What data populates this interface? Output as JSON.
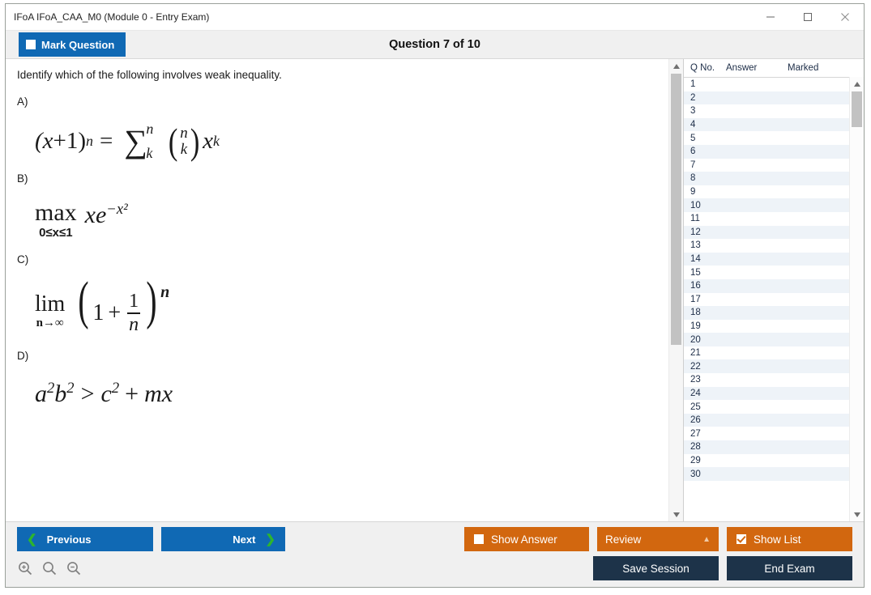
{
  "window": {
    "title": "IFoA IFoA_CAA_M0 (Module 0 - Entry Exam)",
    "minimize_label": "—",
    "maximize_label": "□",
    "close_label": "✕"
  },
  "header": {
    "mark_question_label": "Mark Question",
    "mark_question_checked": false,
    "question_title": "Question 7 of 10"
  },
  "question": {
    "prompt": "Identify which of the following involves weak inequality.",
    "options": [
      {
        "label": "A)",
        "formula_text": "(x+1)^n = Σ_k^n (n choose k) x^k",
        "lhs_base": "(x",
        "lhs_plus": "+1)",
        "lhs_exp": "n",
        "equals": "=",
        "sigma": "∑",
        "sigma_sup": "n",
        "sigma_sub": "k",
        "binom_top": "n",
        "binom_bottom": "k",
        "tail_base": "x",
        "tail_exp": "k"
      },
      {
        "label": "B)",
        "formula_text": "max (0≤x≤1) x e^{-x^2}",
        "operator": "max",
        "limits": "0≤x≤1",
        "expr_base": "xe",
        "expr_exp": "−x²"
      },
      {
        "label": "C)",
        "formula_text": "lim (n→∞) (1 + 1/n)^n",
        "operator": "lim",
        "limits": "n→∞",
        "paren_open": "(",
        "one": "1",
        "plus": "+",
        "frac_num": "1",
        "frac_den": "n",
        "paren_close": ")",
        "power": "n"
      },
      {
        "label": "D)",
        "formula_text": "a²b² > c² + mx",
        "a": "a",
        "a_exp": "2",
        "b": "b",
        "b_exp": "2",
        "gt": ">",
        "c": "c",
        "c_exp": "2",
        "plus": "+",
        "mx": "mx"
      }
    ]
  },
  "question_list": {
    "columns": [
      "Q No.",
      "Answer",
      "Marked"
    ],
    "rows": [
      {
        "q": "1",
        "answer": "",
        "marked": ""
      },
      {
        "q": "2",
        "answer": "",
        "marked": ""
      },
      {
        "q": "3",
        "answer": "",
        "marked": ""
      },
      {
        "q": "4",
        "answer": "",
        "marked": ""
      },
      {
        "q": "5",
        "answer": "",
        "marked": ""
      },
      {
        "q": "6",
        "answer": "",
        "marked": ""
      },
      {
        "q": "7",
        "answer": "",
        "marked": ""
      },
      {
        "q": "8",
        "answer": "",
        "marked": ""
      },
      {
        "q": "9",
        "answer": "",
        "marked": ""
      },
      {
        "q": "10",
        "answer": "",
        "marked": ""
      },
      {
        "q": "11",
        "answer": "",
        "marked": ""
      },
      {
        "q": "12",
        "answer": "",
        "marked": ""
      },
      {
        "q": "13",
        "answer": "",
        "marked": ""
      },
      {
        "q": "14",
        "answer": "",
        "marked": ""
      },
      {
        "q": "15",
        "answer": "",
        "marked": ""
      },
      {
        "q": "16",
        "answer": "",
        "marked": ""
      },
      {
        "q": "17",
        "answer": "",
        "marked": ""
      },
      {
        "q": "18",
        "answer": "",
        "marked": ""
      },
      {
        "q": "19",
        "answer": "",
        "marked": ""
      },
      {
        "q": "20",
        "answer": "",
        "marked": ""
      },
      {
        "q": "21",
        "answer": "",
        "marked": ""
      },
      {
        "q": "22",
        "answer": "",
        "marked": ""
      },
      {
        "q": "23",
        "answer": "",
        "marked": ""
      },
      {
        "q": "24",
        "answer": "",
        "marked": ""
      },
      {
        "q": "25",
        "answer": "",
        "marked": ""
      },
      {
        "q": "26",
        "answer": "",
        "marked": ""
      },
      {
        "q": "27",
        "answer": "",
        "marked": ""
      },
      {
        "q": "28",
        "answer": "",
        "marked": ""
      },
      {
        "q": "29",
        "answer": "",
        "marked": ""
      },
      {
        "q": "30",
        "answer": "",
        "marked": ""
      }
    ]
  },
  "footer": {
    "previous_label": "Previous",
    "next_label": "Next",
    "previous_chevron": "❮",
    "next_chevron": "❯",
    "show_answer_label": "Show Answer",
    "show_answer_checked": false,
    "review_label": "Review",
    "review_caret": "▲",
    "show_list_label": "Show List",
    "show_list_checked": true,
    "save_session_label": "Save Session",
    "end_exam_label": "End Exam",
    "zoom_in_icon": "zoom-in-icon",
    "zoom_reset_icon": "zoom-reset-icon",
    "zoom_out_icon": "zoom-out-icon"
  },
  "colors": {
    "blue": "#1069b4",
    "orange": "#d2670f",
    "dark": "#1d3349",
    "green_chevron": "#2db52d",
    "row_alt": "#eef3f8"
  }
}
